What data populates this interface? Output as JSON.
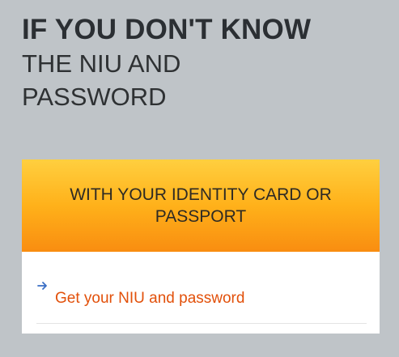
{
  "heading": {
    "line1": "IF YOU DON'T KNOW",
    "line2": "THE NIU AND",
    "line3": "PASSWORD"
  },
  "card": {
    "header_text": "WITH YOUR IDENTITY CARD OR PASSPORT",
    "link_label": "Get your NIU and password",
    "link_icon": "arrow-right-icon"
  },
  "colors": {
    "background": "#bfc4c8",
    "header_gradient_top": "#ffcf3f",
    "header_gradient_bottom": "#f98d10",
    "link": "#e2500a",
    "arrow": "#3a6fc5"
  }
}
